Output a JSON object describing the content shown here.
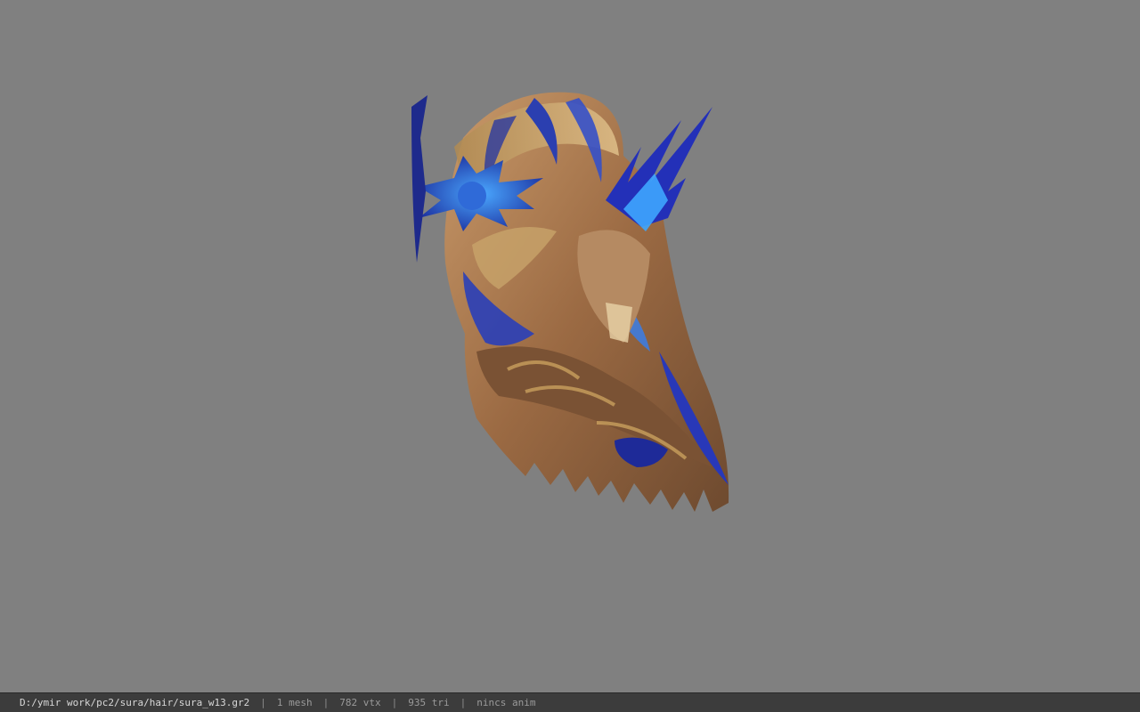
{
  "viewer": {
    "background_color": "#808080",
    "model_icon": "hair-mesh-model"
  },
  "status_bar": {
    "file_path": "D:/ymir work/pc2/sura/hair/sura_w13.gr2",
    "separator": "|",
    "mesh_count": "1 mesh",
    "vertex_count": "782 vtx",
    "triangle_count": "935 tri",
    "anim_status": "nincs anim"
  }
}
